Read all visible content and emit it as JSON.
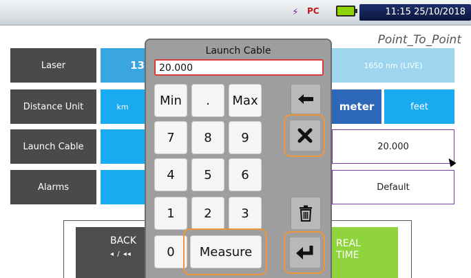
{
  "status": {
    "time": "11:15 25/10/2018",
    "battery_color": "#8fd400"
  },
  "title": "Point_To_Point",
  "rows": {
    "laser": {
      "label": "Laser",
      "value_left": "13",
      "value_right": "1650 nm (LIVE)"
    },
    "distance_unit": {
      "label": "Distance Unit",
      "option_km": "km",
      "option_meter": "meter",
      "option_feet": "feet"
    },
    "launch_cable": {
      "label": "Launch Cable",
      "value": "20.000"
    },
    "alarms": {
      "label": "Alarms",
      "value": "Default"
    }
  },
  "bottom": {
    "back_label": "BACK",
    "back_sub": "◂ / ◂◂",
    "realtime_label": "REAL TIME"
  },
  "keypad": {
    "title": "Launch Cable",
    "input_value": "20.000",
    "keys": {
      "min": "Min",
      "dot": ".",
      "max": "Max",
      "k7": "7",
      "k8": "8",
      "k9": "9",
      "k4": "4",
      "k5": "5",
      "k6": "6",
      "k1": "1",
      "k2": "2",
      "k3": "3",
      "k0": "0",
      "measure": "Measure"
    },
    "icons": [
      "backspace-icon",
      "clear-icon",
      "trash-icon",
      "enter-icon"
    ]
  },
  "colors": {
    "accent_blue": "#19aaf0",
    "highlight_orange": "#f0953a",
    "realtime_green": "#8fd43d"
  }
}
